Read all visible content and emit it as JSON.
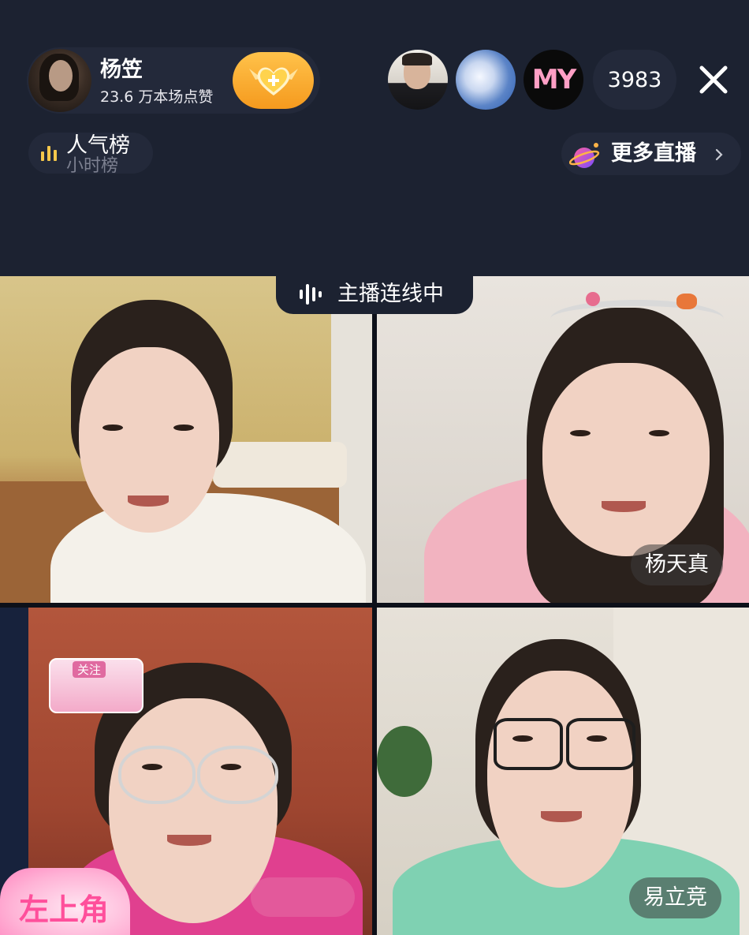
{
  "host": {
    "name": "杨笠",
    "likes": "23.6 万本场点赞"
  },
  "viewers": {
    "count": "3983",
    "avatar3_text": "MY"
  },
  "rank": {
    "label": "人气榜",
    "sub_label": "小时榜"
  },
  "more_live": {
    "label": "更多直播"
  },
  "connect": {
    "label": "主播连线中"
  },
  "guests": [
    {
      "name": ""
    },
    {
      "name": "杨天真"
    },
    {
      "name": ""
    },
    {
      "name": "易立竞"
    }
  ],
  "stickers": {
    "follow_card_label": "关注",
    "corner_sticker": "左上角"
  },
  "colors": {
    "background": "#1c2231",
    "chip_bg": "#23293a",
    "fan_gold": "#f5a623",
    "rank_yellow": "#f6c84b"
  },
  "icons": {
    "fan": "heart-plus-icon",
    "close": "close-icon",
    "rank": "bar-chart-icon",
    "more_live": "planet-icon",
    "connect": "audio-wave-icon"
  }
}
